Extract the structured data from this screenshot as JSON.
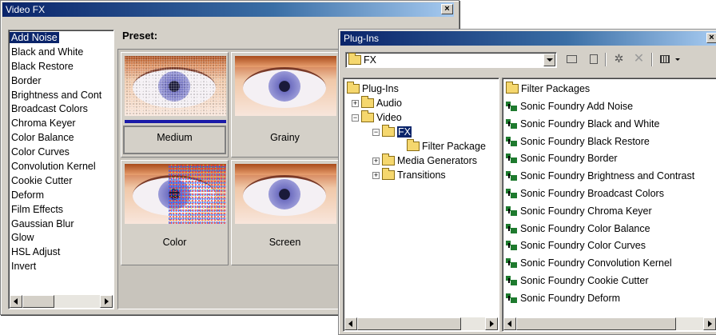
{
  "video_fx": {
    "title": "Video FX",
    "close_glyph": "×",
    "effects": [
      "Add Noise",
      "Black and White",
      "Black Restore",
      "Border",
      "Brightness and Cont",
      "Broadcast Colors",
      "Chroma Keyer",
      "Color Balance",
      "Color Curves",
      "Convolution Kernel",
      "Cookie Cutter",
      "Deform",
      "Film Effects",
      "Gaussian Blur",
      "Glow",
      "HSL Adjust",
      "Invert"
    ],
    "selected_index": 0,
    "preset_label": "Preset:",
    "presets": [
      "Medium",
      "Grainy",
      "Color",
      "Screen"
    ],
    "selected_preset": "Medium"
  },
  "plugins": {
    "title": "Plug-Ins",
    "path_value": "FX",
    "toolbar_icons": [
      "up-folder-icon",
      "refresh-icon",
      "new-package-icon",
      "delete-icon",
      "view-icon",
      "dropdown-arrow-icon"
    ],
    "tree": {
      "root": "Plug-Ins",
      "audio": "Audio",
      "video": "Video",
      "fx": "FX",
      "filter_package": "Filter Package",
      "media_generators": "Media Generators",
      "transitions": "Transitions"
    },
    "list_folder": "Filter Packages",
    "list_items": [
      "Sonic Foundry Add Noise",
      "Sonic Foundry Black and White",
      "Sonic Foundry Black Restore",
      "Sonic Foundry Border",
      "Sonic Foundry Brightness and Contrast",
      "Sonic Foundry Broadcast Colors",
      "Sonic Foundry Chroma Keyer",
      "Sonic Foundry Color Balance",
      "Sonic Foundry Color Curves",
      "Sonic Foundry Convolution Kernel",
      "Sonic Foundry Cookie Cutter",
      "Sonic Foundry Deform"
    ]
  },
  "colors": {
    "titlebar": "#0a246a",
    "selection": "#0a246a",
    "progress_bar": "#1a1aa8",
    "folder_yellow": "#f5d76e",
    "plugin_green": "#1e7a2e"
  }
}
